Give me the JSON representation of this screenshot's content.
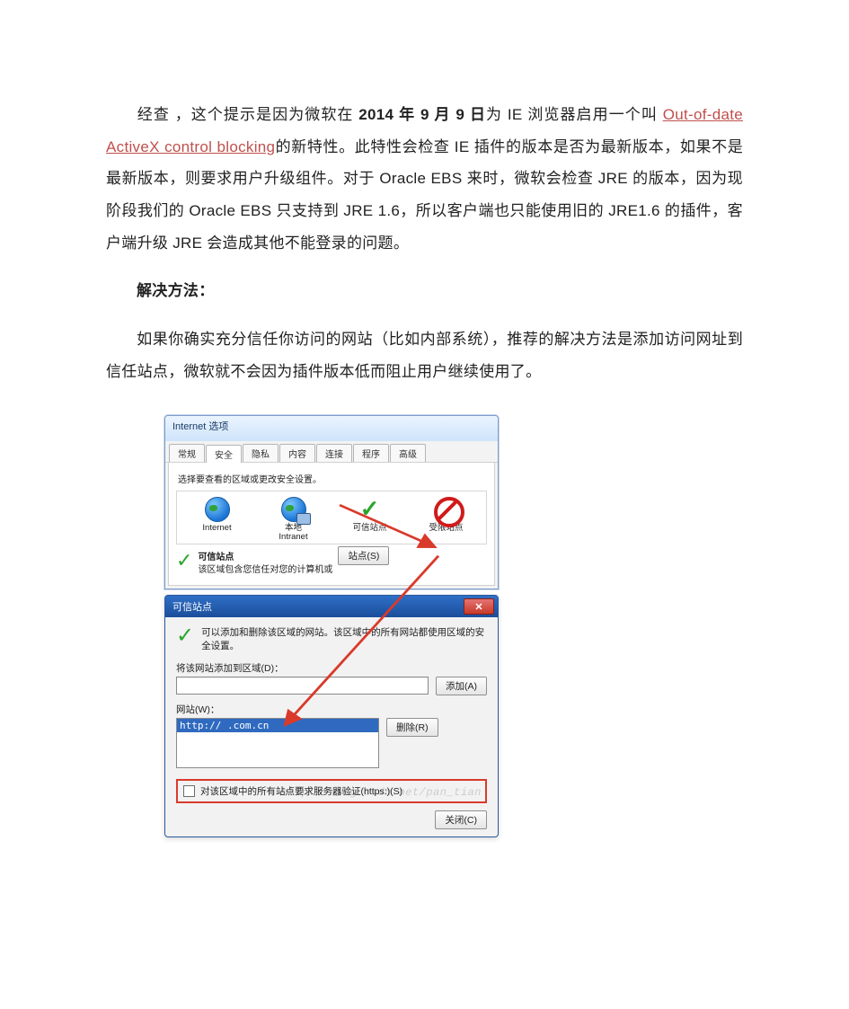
{
  "p1": {
    "a": "经查 ，这个提示是因为微软在 ",
    "b": "2014 年 9 月 9 日",
    "c": "为 IE 浏览器启用一个叫 ",
    "link": "Out-of-date ActiveX control blocking",
    "d": "的新特性。此特性会检查 IE 插件的版本是否为最新版本，如果不是最新版本，则要求用户升级组件。对于 Oracle EBS 来时，微软会检查 JRE 的版本，因为现阶段我们的 Oracle EBS 只支持到 JRE 1.6，所以客户端也只能使用旧的 JRE1.6 的插件，客户端升级 JRE 会造成其他不能登录的问题。"
  },
  "p2": "解决方法：",
  "p3": "如果你确实充分信任你访问的网站（比如内部系统），推荐的解决方法是添加访问网址到信任站点，微软就不会因为插件版本低而阻止用户继续使用了。",
  "dlg1": {
    "title": "Internet 选项",
    "tabs": [
      "常规",
      "安全",
      "隐私",
      "内容",
      "连接",
      "程序",
      "高级"
    ],
    "zones_label": "选择要查看的区域或更改安全设置。",
    "zones": [
      {
        "name": "Internet"
      },
      {
        "name": "本地\nIntranet"
      },
      {
        "name": "可信站点"
      },
      {
        "name": "受限站点"
      }
    ],
    "chosen_title": "可信站点",
    "chosen_desc": "该区域包含您信任对您的计算机或",
    "sites_btn": "站点(S)"
  },
  "dlg2": {
    "title": "可信站点",
    "intro": "可以添加和删除该区域的网站。该区域中的所有网站都使用区域的安全设置。",
    "add_label": "将该网站添加到区域(D)：",
    "add_btn": "添加(A)",
    "list_label": "网站(W)：",
    "list_value": "http://          .com.cn",
    "del_btn": "删除(R)",
    "https_check": "对该区域中的所有站点要求服务器验证(https:)(S)",
    "close_btn": "关闭(C)"
  },
  "watermark": "http://blog.csdn.net/pan_tian"
}
